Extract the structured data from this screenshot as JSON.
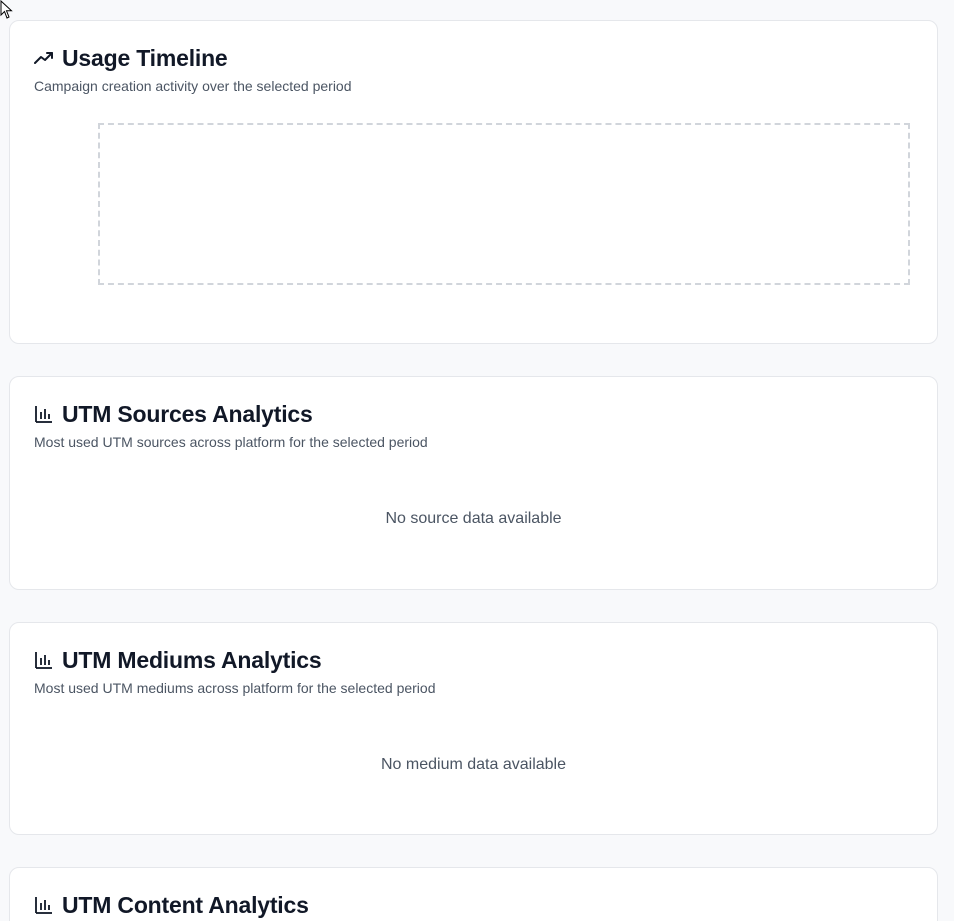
{
  "cards": {
    "timeline": {
      "title": "Usage Timeline",
      "subtitle": "Campaign creation activity over the selected period",
      "icon": "trending-up-icon"
    },
    "sources": {
      "title": "UTM Sources Analytics",
      "subtitle": "Most used UTM sources across platform for the selected period",
      "empty": "No source data available",
      "icon": "bar-chart-icon"
    },
    "mediums": {
      "title": "UTM Mediums Analytics",
      "subtitle": "Most used UTM mediums across platform for the selected period",
      "empty": "No medium data available",
      "icon": "bar-chart-icon"
    },
    "content": {
      "title": "UTM Content Analytics",
      "icon": "bar-chart-icon"
    }
  }
}
